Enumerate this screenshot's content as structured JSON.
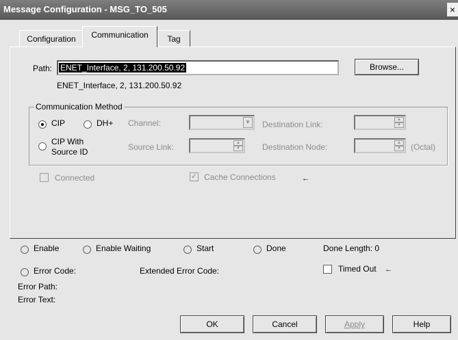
{
  "window": {
    "title": "Message Configuration - MSG_TO_505",
    "close_glyph": "×"
  },
  "tabs": [
    {
      "label": "Configuration"
    },
    {
      "label": "Communication"
    },
    {
      "label": "Tag"
    }
  ],
  "path": {
    "label": "Path:",
    "value": "ENET_Interface, 2, 131.200.50.92",
    "resolved": "ENET_Interface, 2, 131.200.50.92",
    "browse_label": "Browse..."
  },
  "comm_method": {
    "title": "Communication Method",
    "cip_label": "CIP",
    "dhplus_label": "DH+",
    "cip_source_label_line1": "CIP With",
    "cip_source_label_line2": "Source ID",
    "channel_label": "Channel:",
    "dest_link_label": "Destination Link:",
    "source_link_label": "Source Link:",
    "dest_node_label": "Destination Node:",
    "octal_label": "(Octal)"
  },
  "options": {
    "connected_label": "Connected",
    "cache_label": "Cache Connections",
    "arrow_glyph": "←"
  },
  "status": {
    "enable": "Enable",
    "enable_waiting": "Enable Waiting",
    "start": "Start",
    "done": "Done",
    "done_length": "Done Length: 0",
    "error_code": "Error Code:",
    "extended_error_code": "Extended Error Code:",
    "timed_out": "Timed Out",
    "error_path": "Error Path:",
    "error_text": "Error Text:"
  },
  "buttons": {
    "ok": "OK",
    "cancel": "Cancel",
    "apply": "Apply",
    "help": "Help"
  },
  "colors": {
    "titlebar": "#6b6b6b",
    "face": "#e6e6e6",
    "disabled_text": "#8c8c8c"
  }
}
